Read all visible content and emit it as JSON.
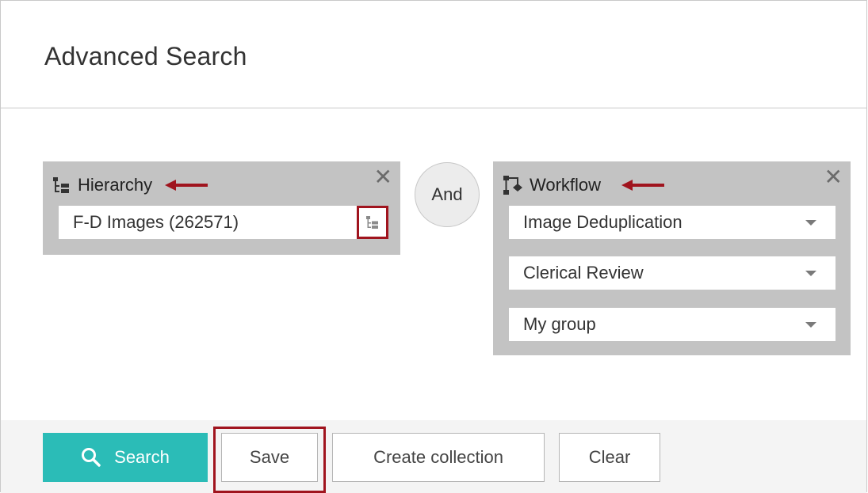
{
  "dialog": {
    "title": "Advanced Search"
  },
  "hierarchy_card": {
    "icon": "hierarchy-icon",
    "title": "Hierarchy",
    "value": "F-D Images (262571)",
    "close_label": "✕",
    "picker_icon": "hierarchy-picker-icon"
  },
  "operator": {
    "label": "And"
  },
  "workflow_card": {
    "icon": "workflow-icon",
    "title": "Workflow",
    "close_label": "✕",
    "selects": [
      {
        "value": "Image Deduplication"
      },
      {
        "value": "Clerical Review"
      },
      {
        "value": "My group"
      }
    ]
  },
  "footer": {
    "search_label": "Search",
    "search_icon": "search-icon",
    "save_label": "Save",
    "create_collection_label": "Create collection",
    "clear_label": "Clear"
  },
  "colors": {
    "accent": "#2bbcb7",
    "highlight": "#a0141e",
    "card_bg": "#c3c3c3"
  }
}
